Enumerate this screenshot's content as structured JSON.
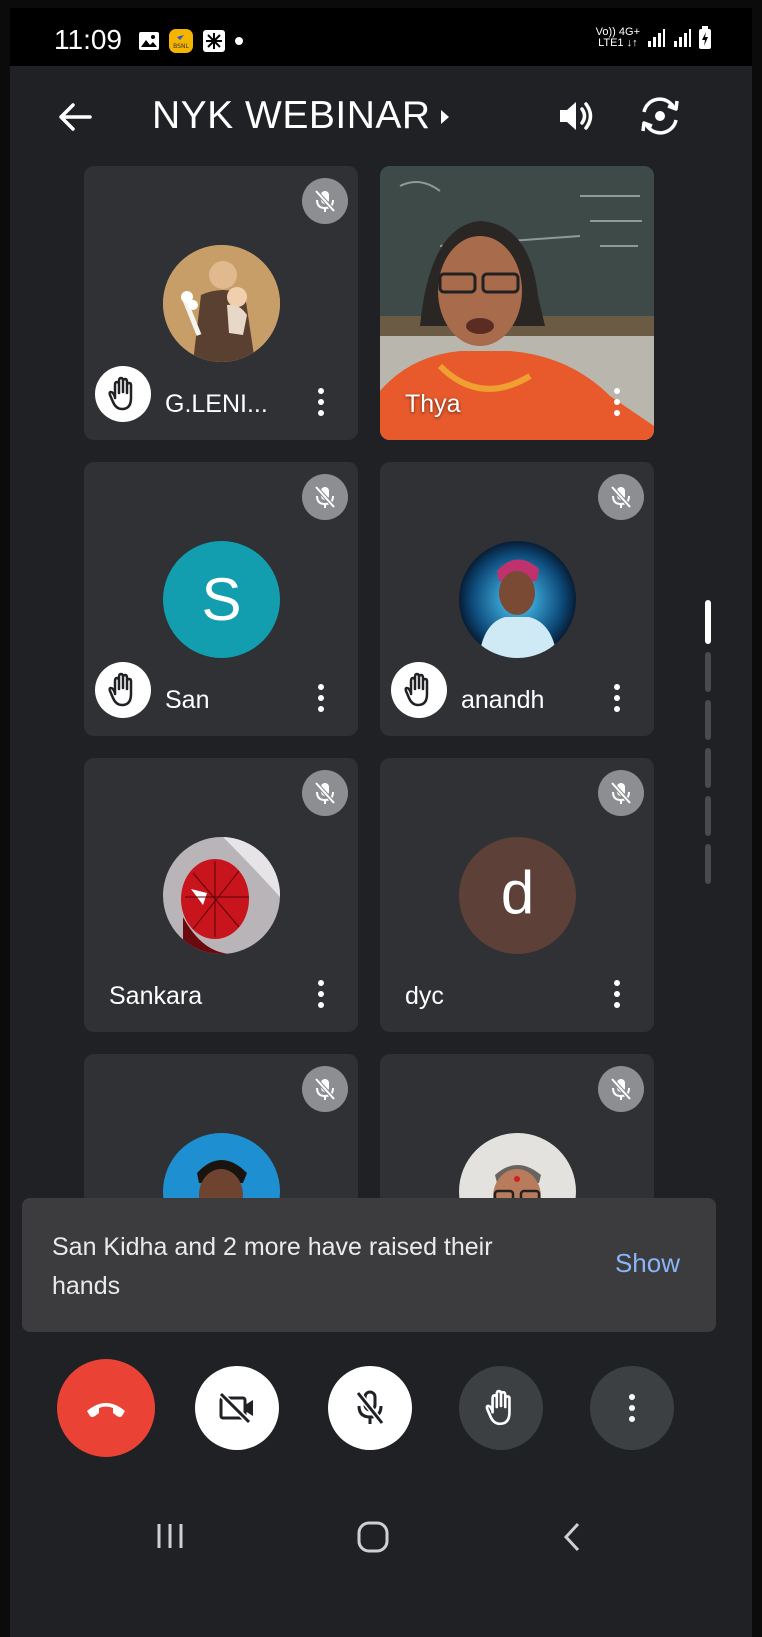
{
  "status_bar": {
    "time": "11:09",
    "network_top": "Vo)) 4G+",
    "network_bottom": "LTE1 ↓↑",
    "icons": [
      "gallery-icon",
      "bsnl-app-icon",
      "app-grid-icon",
      "dot-icon",
      "signal-icon",
      "signal-icon",
      "battery-charging-icon"
    ]
  },
  "header": {
    "title": "NYK WEBINAR",
    "icons": [
      "back-arrow-icon",
      "caret-right-icon",
      "speaker-icon",
      "switch-camera-icon"
    ]
  },
  "participants": [
    {
      "name": "G.LENI...",
      "hand_raised": true,
      "muted": true,
      "avatar": "photo",
      "avatar_icon": "saint-photo-avatar"
    },
    {
      "name": "Thya",
      "hand_raised": false,
      "muted": false,
      "avatar": "video",
      "avatar_icon": "live-video-feed"
    },
    {
      "name": "San",
      "hand_raised": true,
      "muted": true,
      "avatar": "letter",
      "letter": "S",
      "avatar_color": "#129eaf"
    },
    {
      "name": "anandh",
      "hand_raised": true,
      "muted": true,
      "avatar": "photo",
      "avatar_icon": "person-photo-avatar"
    },
    {
      "name": "Sankara",
      "hand_raised": false,
      "muted": true,
      "avatar": "photo",
      "avatar_icon": "spiderman-photo-avatar"
    },
    {
      "name": "dyc",
      "hand_raised": false,
      "muted": true,
      "avatar": "letter",
      "letter": "d",
      "avatar_color": "#5d4037"
    },
    {
      "name": "",
      "hand_raised": false,
      "muted": true,
      "avatar": "photo",
      "avatar_icon": "person-photo-avatar"
    },
    {
      "name": "",
      "hand_raised": false,
      "muted": true,
      "avatar": "photo",
      "avatar_icon": "person-glasses-photo-avatar"
    }
  ],
  "notification": {
    "message": "San Kidha and 2 more have raised their hands",
    "action": "Show"
  },
  "controls": {
    "icons": [
      "end-call-icon",
      "camera-off-icon",
      "mic-off-icon",
      "raise-hand-icon",
      "more-options-icon"
    ]
  },
  "colors": {
    "background": "#202124",
    "tile": "#303134",
    "end_call": "#ea4335",
    "link": "#8ab4f8"
  }
}
